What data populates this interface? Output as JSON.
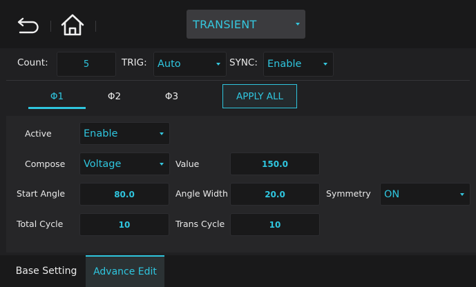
{
  "header": {
    "back_icon": "back-arrow-icon",
    "home_icon": "home-icon",
    "mode": "TRANSIENT",
    "accent_color": "#35c7de"
  },
  "settings": {
    "count_label": "Count:",
    "count_value": "5",
    "trig_label": "TRIG:",
    "trig_value": "Auto",
    "sync_label": "SYNC:",
    "sync_value": "Enable"
  },
  "phase_tabs": [
    "Φ1",
    "Φ2",
    "Φ3"
  ],
  "active_phase": "Φ1",
  "apply_all_label": "APPLY ALL",
  "form": {
    "active_label": "Active",
    "active_value": "Enable",
    "compose_label": "Compose",
    "compose_value": "Voltage",
    "value_label": "Value",
    "value_value": "150.0",
    "start_angle_label": "Start Angle",
    "start_angle_value": "80.0",
    "angle_width_label": "Angle Width",
    "angle_width_value": "20.0",
    "symmetry_label": "Symmetry",
    "symmetry_value": "ON",
    "total_cycle_label": "Total Cycle",
    "total_cycle_value": "10",
    "trans_cycle_label": "Trans Cycle",
    "trans_cycle_value": "10"
  },
  "bottom_tabs": [
    "Base Setting",
    "Advance Edit"
  ],
  "active_bottom_tab": "Advance Edit"
}
